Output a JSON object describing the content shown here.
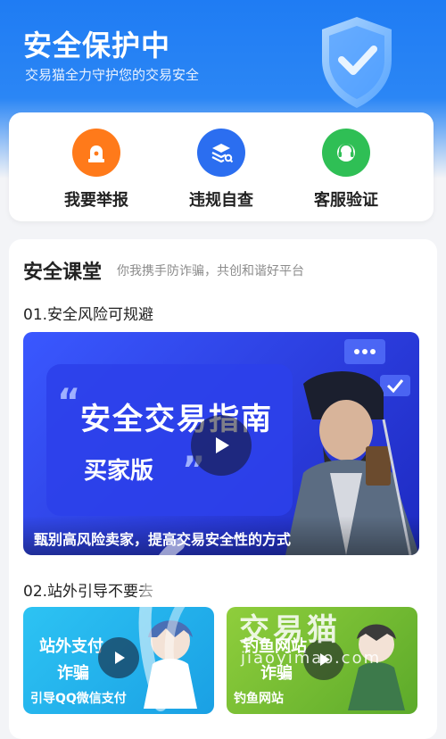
{
  "header": {
    "title": "安全保护中",
    "subtitle": "交易猫全力守护您的交易安全"
  },
  "quick_actions": [
    {
      "label": "我要举报",
      "icon": "alarm-icon",
      "color": "#ff7a1a"
    },
    {
      "label": "违规自查",
      "icon": "layers-search-icon",
      "color": "#2b6ef0"
    },
    {
      "label": "客服验证",
      "icon": "support-headset-icon",
      "color": "#2fbf55"
    }
  ],
  "safety_class": {
    "title": "安全课堂",
    "subtitle": "你我携手防诈骗，共创和谐好平台",
    "section1": "01.安全风险可规避",
    "section2": "02.站外引导不要去",
    "main_video": {
      "headline": "安全交易指南",
      "subheadline": "买家版",
      "caption": "甄别高风险卖家，提高交易安全性的方式"
    },
    "videos": [
      {
        "title_line1": "站外支付",
        "title_line2": "诈骗",
        "caption": "引导QQ微信支付"
      },
      {
        "title_line1": "钓鱼网站",
        "title_line2": "诈骗",
        "caption": "钓鱼网站"
      }
    ]
  },
  "watermark": {
    "text": "交易猫",
    "url": "jiaoyimao.com"
  }
}
